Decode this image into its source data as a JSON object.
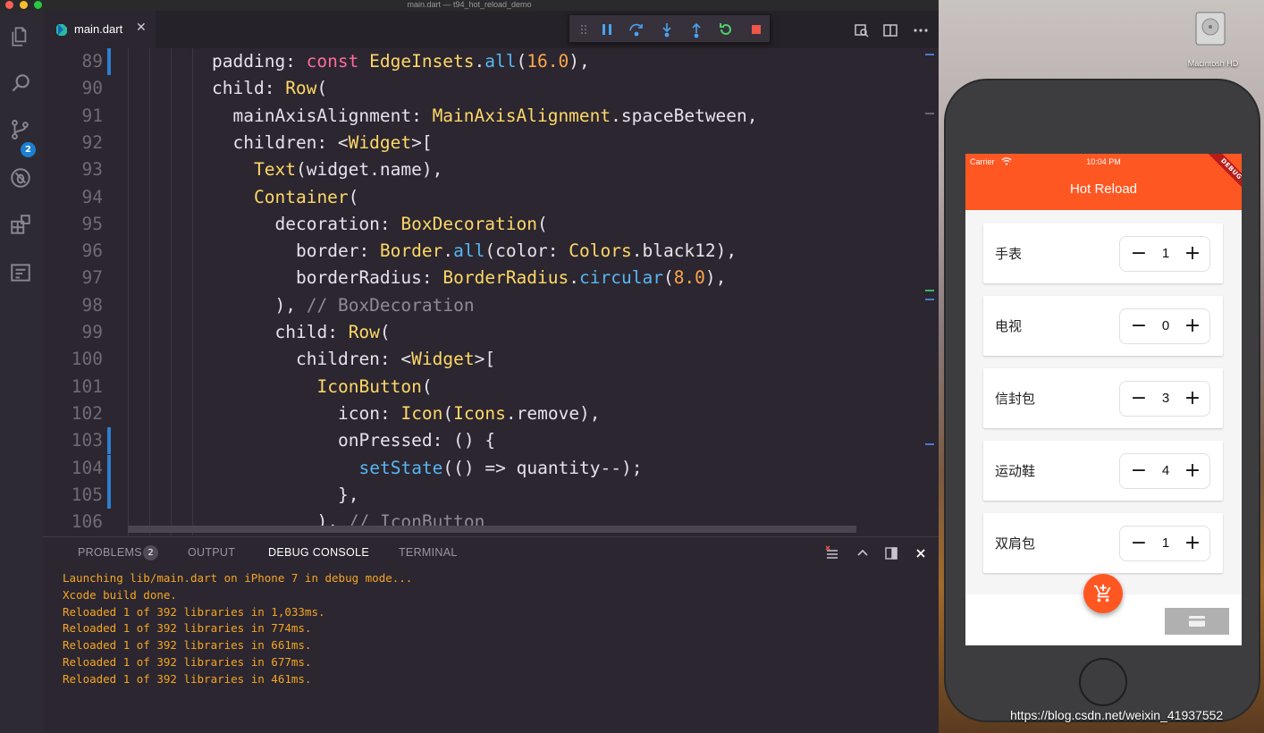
{
  "window": {
    "title": "main.dart — t94_hot_reload_demo"
  },
  "activity_bar": {
    "scm_badge": "2"
  },
  "tab": {
    "label": "main.dart",
    "close": "✕"
  },
  "editor": {
    "lines": [
      {
        "n": "89",
        "indent": 4,
        "mark": true,
        "tokens": [
          [
            "def",
            "padding: "
          ],
          [
            "kw",
            "const "
          ],
          [
            "ty",
            "EdgeInsets"
          ],
          [
            "def",
            "."
          ],
          [
            "fn",
            "all"
          ],
          [
            "def",
            "("
          ],
          [
            "num",
            "16.0"
          ],
          [
            "def",
            "),"
          ]
        ]
      },
      {
        "n": "90",
        "indent": 4,
        "mark": false,
        "tokens": [
          [
            "def",
            "child: "
          ],
          [
            "ty",
            "Row"
          ],
          [
            "def",
            "("
          ]
        ]
      },
      {
        "n": "91",
        "indent": 5,
        "mark": false,
        "tokens": [
          [
            "def",
            "mainAxisAlignment: "
          ],
          [
            "ty",
            "MainAxisAlignment"
          ],
          [
            "def",
            ".spaceBetween,"
          ]
        ]
      },
      {
        "n": "92",
        "indent": 5,
        "mark": false,
        "tokens": [
          [
            "def",
            "children: <"
          ],
          [
            "ty",
            "Widget"
          ],
          [
            "def",
            ">["
          ]
        ]
      },
      {
        "n": "93",
        "indent": 6,
        "mark": false,
        "tokens": [
          [
            "ty",
            "Text"
          ],
          [
            "def",
            "(widget.name),"
          ]
        ]
      },
      {
        "n": "94",
        "indent": 6,
        "mark": false,
        "tokens": [
          [
            "ty",
            "Container"
          ],
          [
            "def",
            "("
          ]
        ]
      },
      {
        "n": "95",
        "indent": 7,
        "mark": false,
        "tokens": [
          [
            "def",
            "decoration: "
          ],
          [
            "ty",
            "BoxDecoration"
          ],
          [
            "def",
            "("
          ]
        ]
      },
      {
        "n": "96",
        "indent": 8,
        "mark": false,
        "tokens": [
          [
            "def",
            "border: "
          ],
          [
            "ty",
            "Border"
          ],
          [
            "def",
            "."
          ],
          [
            "fn",
            "all"
          ],
          [
            "def",
            "(color: "
          ],
          [
            "ty",
            "Colors"
          ],
          [
            "def",
            ".black12),"
          ]
        ]
      },
      {
        "n": "97",
        "indent": 8,
        "mark": false,
        "tokens": [
          [
            "def",
            "borderRadius: "
          ],
          [
            "ty",
            "BorderRadius"
          ],
          [
            "def",
            "."
          ],
          [
            "fn",
            "circular"
          ],
          [
            "def",
            "("
          ],
          [
            "num",
            "8.0"
          ],
          [
            "def",
            "),"
          ]
        ]
      },
      {
        "n": "98",
        "indent": 7,
        "mark": false,
        "tokens": [
          [
            "def",
            "), "
          ],
          [
            "cm",
            "// BoxDecoration"
          ]
        ]
      },
      {
        "n": "99",
        "indent": 7,
        "mark": false,
        "tokens": [
          [
            "def",
            "child: "
          ],
          [
            "ty",
            "Row"
          ],
          [
            "def",
            "("
          ]
        ]
      },
      {
        "n": "100",
        "indent": 8,
        "mark": false,
        "tokens": [
          [
            "def",
            "children: <"
          ],
          [
            "ty",
            "Widget"
          ],
          [
            "def",
            ">["
          ]
        ]
      },
      {
        "n": "101",
        "indent": 9,
        "mark": false,
        "tokens": [
          [
            "ty",
            "IconButton"
          ],
          [
            "def",
            "("
          ]
        ]
      },
      {
        "n": "102",
        "indent": 10,
        "mark": false,
        "tokens": [
          [
            "def",
            "icon: "
          ],
          [
            "ty",
            "Icon"
          ],
          [
            "def",
            "("
          ],
          [
            "ty",
            "Icons"
          ],
          [
            "def",
            ".remove),"
          ]
        ]
      },
      {
        "n": "103",
        "indent": 10,
        "mark": true,
        "tokens": [
          [
            "def",
            "onPressed: () {"
          ]
        ]
      },
      {
        "n": "104",
        "indent": 11,
        "mark": true,
        "tokens": [
          [
            "fn",
            "setState"
          ],
          [
            "def",
            "(() => quantity--);"
          ]
        ]
      },
      {
        "n": "105",
        "indent": 10,
        "mark": true,
        "tokens": [
          [
            "def",
            "},"
          ]
        ]
      },
      {
        "n": "106",
        "indent": 9,
        "mark": false,
        "tokens": [
          [
            "def",
            "), "
          ],
          [
            "cm",
            "// IconButton"
          ]
        ]
      }
    ]
  },
  "panel": {
    "tabs": {
      "problems": "PROBLEMS",
      "output": "OUTPUT",
      "debug_console": "DEBUG CONSOLE",
      "terminal": "TERMINAL"
    },
    "problems_badge": "2",
    "output": [
      "Launching lib/main.dart on iPhone 7 in debug mode...",
      "Xcode build done.",
      "Reloaded 1 of 392 libraries in 1,033ms.",
      "Reloaded 1 of 392 libraries in 774ms.",
      "Reloaded 1 of 392 libraries in 661ms.",
      "Reloaded 1 of 392 libraries in 677ms.",
      "Reloaded 1 of 392 libraries in 461ms."
    ]
  },
  "desktop": {
    "drive_label": "Macintosh HD",
    "watermark": "https://blog.csdn.net/weixin_41937552"
  },
  "phone": {
    "carrier": "Carrier",
    "time": "10:04 PM",
    "title": "Hot Reload",
    "debug_banner": "DEBUG",
    "items": [
      {
        "name": "手表",
        "qty": "1"
      },
      {
        "name": "电视",
        "qty": "0"
      },
      {
        "name": "信封包",
        "qty": "3"
      },
      {
        "name": "运动鞋",
        "qty": "4"
      },
      {
        "name": "双肩包",
        "qty": "1"
      }
    ],
    "minus": "−",
    "plus": "+"
  },
  "colors": {
    "accent": "#ff5722",
    "keyword": "#ff6b9d",
    "type": "#ffd866",
    "function": "#58b6f2",
    "number": "#ffa64a",
    "comment": "#8f8a94",
    "console": "#f5a623"
  },
  "icons": {
    "activity": [
      "explorer-icon",
      "search-icon",
      "source-control-icon",
      "debug-icon",
      "extensions-icon",
      "flutter-outline-icon"
    ],
    "debug_toolbar": [
      "drag-handle-icon",
      "pause-icon",
      "step-over-icon",
      "step-into-icon",
      "step-out-icon",
      "hot-restart-icon",
      "stop-icon"
    ],
    "editor_actions": [
      "open-devtools-icon",
      "split-editor-icon",
      "more-actions-icon"
    ],
    "panel_actions": [
      "clear-console-icon",
      "collapse-panel-icon",
      "maximize-panel-icon",
      "close-panel-icon"
    ],
    "phone": [
      "wifi-icon",
      "add-shopping-cart-icon",
      "payment-icon"
    ]
  }
}
